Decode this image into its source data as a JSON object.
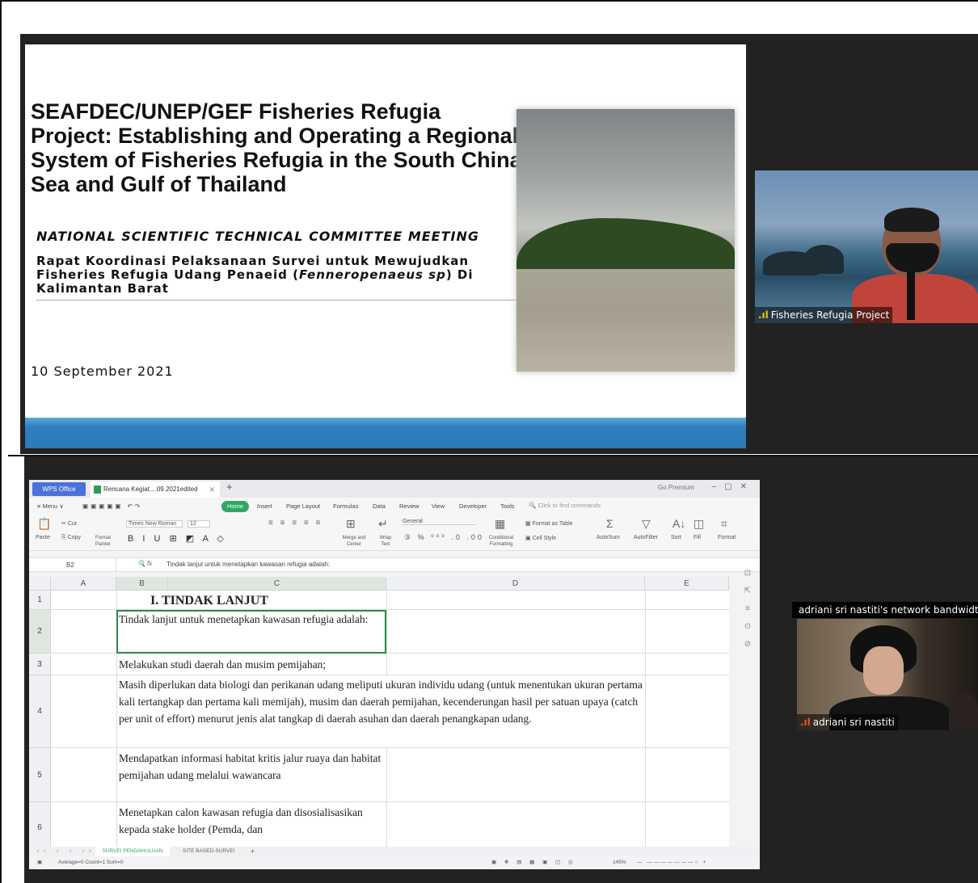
{
  "slide": {
    "title": "SEAFDEC/UNEP/GEF Fisheries Refugia Project: Establishing and Operating a Regional System of Fisheries Refugia in the South China Sea and Gulf of Thailand",
    "meeting": "NATIONAL SCIENTIFIC TECHNICAL COMMITTEE MEETING",
    "subtitle_pre": "Rapat Koordinasi Pelaksanaan Survei untuk Mewujudkan Fisheries Refugia Udang Penaeid (",
    "subtitle_italic": "Fenneropenaeus sp",
    "subtitle_post": ") Di Kalimantan Barat",
    "date": "10 September 2021"
  },
  "video1": {
    "name": "Fisheries Refugia Project",
    "signal_icon": "signal-bars-icon"
  },
  "video2": {
    "notice": "adriani sri nastiti's network bandwidth is lo",
    "name": "adriani sri nastiti"
  },
  "wps": {
    "office_tab": "WPS Office",
    "doc_tab": "Rencana Kegiat....09.2021edited",
    "go_premium": "Go Premium",
    "menu": [
      "≡ Menu ∨",
      "Home",
      "Insert",
      "Page Layout",
      "Formulas",
      "Data",
      "Review",
      "View",
      "Developer",
      "Tools"
    ],
    "search_placeholder": "Click to find commands",
    "ribbon": {
      "paste": "Paste",
      "cut": "Cut",
      "copy": "Copy",
      "format_painter": "Format Painter",
      "font": "Times New Roman",
      "size": "12",
      "merge": "Merge and Center",
      "wrap": "Wrap Text",
      "number_format": "General",
      "conditional": "Conditional Formatting",
      "format_table": "Format as Table",
      "cell_style": "Cell Style",
      "autosum": "AutoSum",
      "autofilter": "AutoFilter",
      "sort": "Sort",
      "fill": "Fill",
      "format": "Format"
    },
    "name_box": "B2",
    "formula": "Tindak lanjut untuk menetapkan kawasan refugia adalah:",
    "columns": [
      "A",
      "B",
      "C",
      "D",
      "E"
    ],
    "rows": [
      "1",
      "2",
      "3",
      "4",
      "5",
      "6"
    ],
    "cells": {
      "r1": "I. TINDAK LANJUT",
      "r2": "Tindak lanjut untuk menetapkan kawasan refugia adalah:",
      "r3": "Melakukan studi daerah dan musim pemijahan;",
      "r4": "Masih diperlukan data biologi dan perikanan udang meliputi ukuran individu udang (untuk menentukan ukuran pertama kali tertangkap dan pertama kali memijah), musim dan daerah pemijahan, kecenderungan hasil per satuan upaya (catch per unit of effort) menurut jenis alat tangkap di daerah asuhan dan daerah penangkapan udang.",
      "r5": "Mendapatkan informasi habitat kritis jalur ruaya dan habitat pemijahan udang melalui wawancara",
      "r6": "Menetapkan calon kawasan refugia dan disosialisasikan kepada stake holder (Pemda, dan"
    },
    "sheet_tabs": [
      "SURVEI PENDAHULUAN",
      "SITE BASED-SURVEI"
    ],
    "status": "Average=0  Count=1  Sum=0",
    "zoom": "145%"
  }
}
